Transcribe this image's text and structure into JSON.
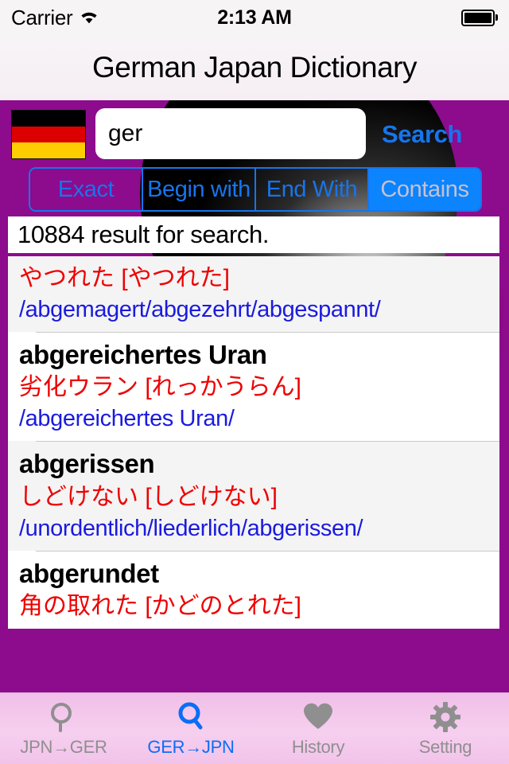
{
  "status_bar": {
    "carrier": "Carrier",
    "wifi_icon": "wifi-icon",
    "time": "2:13 AM",
    "battery_icon": "battery-full-icon"
  },
  "nav": {
    "title": "German Japan Dictionary"
  },
  "search": {
    "flag_icon": "german-flag-icon",
    "input_value": "ger",
    "input_placeholder": "",
    "search_label": "Search",
    "modes": [
      {
        "label": "Exact",
        "selected": false
      },
      {
        "label": "Begin with",
        "selected": false
      },
      {
        "label": "End With",
        "selected": false
      },
      {
        "label": "Contains",
        "selected": true
      }
    ]
  },
  "results": {
    "header": "10884 result for search.",
    "count": 10884,
    "rows": [
      {
        "term": "",
        "reading": "やつれた [やつれた]",
        "gloss": "/abgemagert/abgezehrt/abgespannt/"
      },
      {
        "term": "abgereichertes Uran",
        "reading": "劣化ウラン [れっかうらん]",
        "gloss": "/abgereichertes Uran/"
      },
      {
        "term": "abgerissen",
        "reading": "しどけない [しどけない]",
        "gloss": "/unordentlich/liederlich/abgerissen/"
      },
      {
        "term": "abgerundet",
        "reading": "角の取れた [かどのとれた]",
        "gloss": ""
      }
    ]
  },
  "tab_bar": {
    "tabs": [
      {
        "label": "JPN→GER",
        "icon": "search-magnifier-icon",
        "active": false
      },
      {
        "label": "GER→JPN",
        "icon": "search-magnifier-icon",
        "active": true
      },
      {
        "label": "History",
        "icon": "heart-icon",
        "active": false
      },
      {
        "label": "Setting",
        "icon": "gear-icon",
        "active": false
      }
    ]
  },
  "colors": {
    "background_purple": "#8d0b8d",
    "accent_blue": "#1675ec",
    "selected_segment_blue": "#0b84fe",
    "reading_red": "#ee0000",
    "gloss_blue": "#1a1ae0",
    "tabbar_pink": "#f3c6ec",
    "tab_inactive_gray": "#8f8f8f"
  }
}
